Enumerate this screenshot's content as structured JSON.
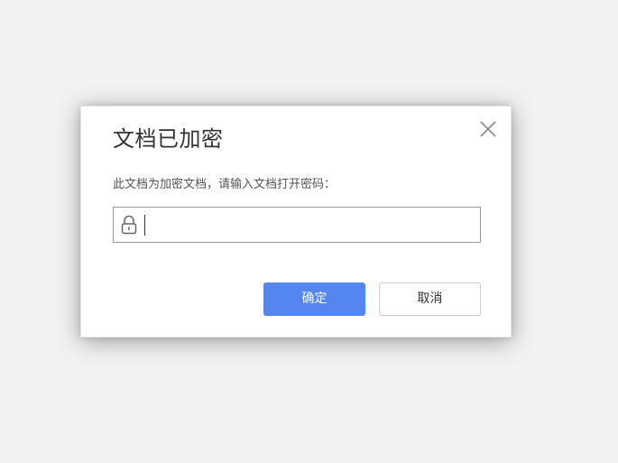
{
  "dialog": {
    "title": "文档已加密",
    "message": "此文档为加密文档，请输入文档打开密码：",
    "password": {
      "value": "",
      "placeholder": ""
    },
    "confirm_label": "确定",
    "cancel_label": "取消",
    "icons": {
      "close": "close-icon",
      "lock": "lock-icon"
    },
    "colors": {
      "primary": "#5585ee",
      "background": "#f2f2f2"
    }
  }
}
